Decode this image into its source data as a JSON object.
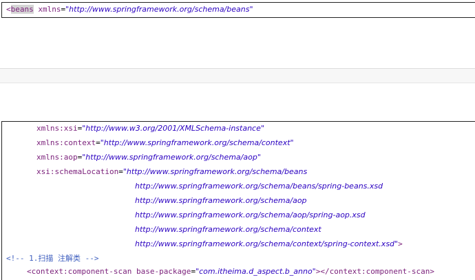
{
  "top": {
    "open_bracket": "<",
    "tag": "beans",
    "attr_name": "xmlns",
    "eq": "=",
    "attr_value": "\"http://www.springframework.org/schema/beans\""
  },
  "bottom": {
    "attrs": [
      {
        "name": "xmlns:xsi",
        "eq": "=",
        "value": "\"http://www.w3.org/2001/XMLSchema-instance\""
      },
      {
        "name": "xmlns:context",
        "eq": "=",
        "value": "\"http://www.springframework.org/schema/context\""
      },
      {
        "name": "xmlns:aop",
        "eq": "=",
        "value": "\"http://www.springframework.org/schema/aop\""
      },
      {
        "name": "xsi:schemaLocation",
        "eq": "=",
        "value": "\"http://www.springframework.org/schema/beans"
      }
    ],
    "schema_lines": [
      "http://www.springframework.org/schema/beans/spring-beans.xsd",
      "http://www.springframework.org/schema/aop",
      "http://www.springframework.org/schema/aop/spring-aop.xsd",
      "http://www.springframework.org/schema/context",
      "http://www.springframework.org/schema/context/spring-context.xsd\""
    ],
    "schema_close": ">",
    "comment": "<!-- 1.扫描 注解类 -->",
    "scan": {
      "open": "<context:component-scan",
      "attr_name": "base-package",
      "eq": "=",
      "attr_value": "\"com.itheima.d_aspect.b_anno\"",
      "close": "></context:component-scan>"
    }
  }
}
